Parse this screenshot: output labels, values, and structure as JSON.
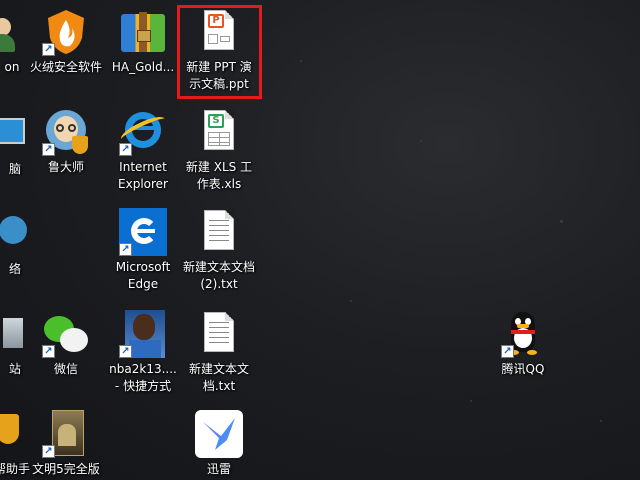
{
  "desktop": {
    "icons": [
      {
        "id": "col0-r0",
        "label": "on"
      },
      {
        "id": "col0-r1",
        "label": "脑"
      },
      {
        "id": "col0-r2",
        "label": "络"
      },
      {
        "id": "col0-r3",
        "label": "站"
      },
      {
        "id": "col0-r4",
        "label": "帮助手"
      },
      {
        "id": "huorong",
        "label": "火绒安全软件"
      },
      {
        "id": "ludashi",
        "label": "鲁大师"
      },
      {
        "id": "wechat",
        "label": "微信"
      },
      {
        "id": "civ5",
        "label": "文明5完全版"
      },
      {
        "id": "ha-gold",
        "label": "HA_Gold..."
      },
      {
        "id": "ie",
        "label": "Internet\nExplorer"
      },
      {
        "id": "edge",
        "label": "Microsoft\nEdge"
      },
      {
        "id": "nba2k13",
        "label": "nba2k13....\n- 快捷方式"
      },
      {
        "id": "ppt",
        "label": "新建 PPT 演\n示文稿.ppt"
      },
      {
        "id": "xls",
        "label": "新建 XLS 工\n作表.xls"
      },
      {
        "id": "txt2",
        "label": "新建文本文档\n(2).txt"
      },
      {
        "id": "txt",
        "label": "新建文本文\n档.txt"
      },
      {
        "id": "xunlei",
        "label": "迅雷"
      },
      {
        "id": "qq",
        "label": "腾讯QQ"
      }
    ]
  },
  "colors": {
    "selection_border": "#e21b1b",
    "edge_blue": "#0a6fd0",
    "wps_orange": "#e8542a",
    "wps_green": "#2e9e5b"
  }
}
